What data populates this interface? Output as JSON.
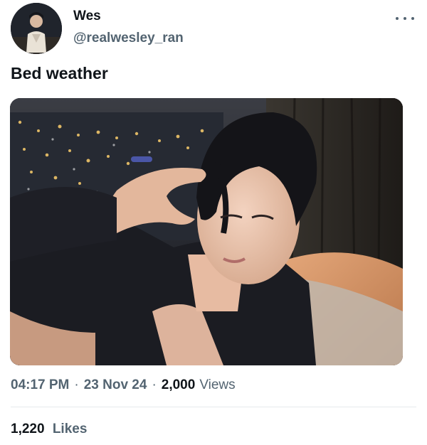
{
  "author": {
    "display_name": "Wes",
    "handle": "@realwesley_ran",
    "avatar_icon": "profile-photo"
  },
  "tweet": {
    "text": "Bed weather",
    "media_icon": "photo"
  },
  "meta": {
    "time": "04:17 PM",
    "separator": "·",
    "date": "23 Nov 24",
    "views_count": "2,000",
    "views_label": "Views"
  },
  "engagement": {
    "likes_count": "1,220",
    "likes_label": "Likes"
  },
  "colors": {
    "text_primary": "#0f1419",
    "text_secondary": "#536471",
    "divider": "#e6e9ec"
  }
}
